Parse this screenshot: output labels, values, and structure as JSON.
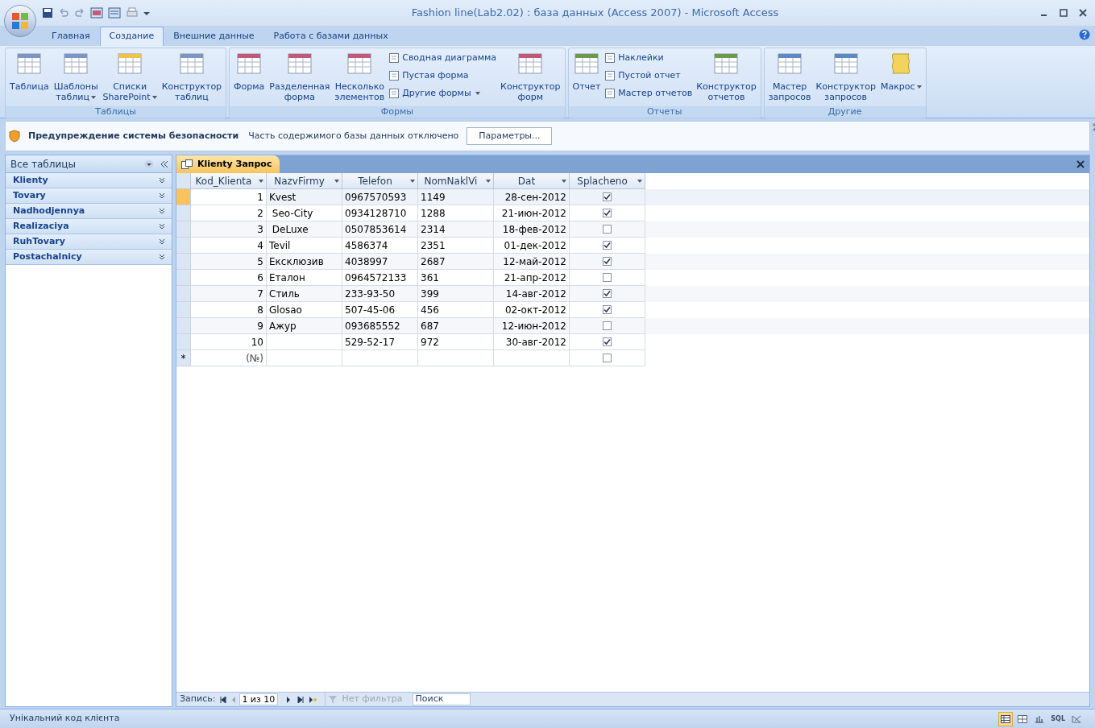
{
  "window": {
    "title": "Fashion line(Lab2.02) : база данных (Access 2007) - Microsoft Access"
  },
  "ribbon_tabs": [
    {
      "label": "Главная",
      "selected": false
    },
    {
      "label": "Создание",
      "selected": true
    },
    {
      "label": "Внешние данные",
      "selected": false
    },
    {
      "label": "Работа с базами данных",
      "selected": false
    }
  ],
  "ribbon_groups": [
    {
      "label": "Таблицы",
      "items": [
        {
          "kind": "large",
          "lines": [
            "Таблица"
          ],
          "dropdown": false
        },
        {
          "kind": "large",
          "lines": [
            "Шаблоны",
            "таблиц"
          ],
          "dropdown": true
        },
        {
          "kind": "large",
          "lines": [
            "Списки",
            "SharePoint"
          ],
          "dropdown": true
        },
        {
          "kind": "large",
          "lines": [
            "Конструктор",
            "таблиц"
          ],
          "dropdown": false
        }
      ]
    },
    {
      "label": "Формы",
      "items": [
        {
          "kind": "large",
          "lines": [
            "Форма"
          ],
          "dropdown": false
        },
        {
          "kind": "large",
          "lines": [
            "Разделенная",
            "форма"
          ],
          "dropdown": false
        },
        {
          "kind": "large",
          "lines": [
            "Несколько",
            "элементов"
          ],
          "dropdown": false
        },
        {
          "kind": "small",
          "lines": [
            "Сводная диаграмма"
          ],
          "dropdown": false
        },
        {
          "kind": "small",
          "lines": [
            "Пустая форма"
          ],
          "dropdown": false
        },
        {
          "kind": "small",
          "lines": [
            "Другие формы"
          ],
          "dropdown": true
        },
        {
          "kind": "large",
          "lines": [
            "Конструктор",
            "форм"
          ],
          "dropdown": false
        }
      ]
    },
    {
      "label": "Отчеты",
      "items": [
        {
          "kind": "large",
          "lines": [
            "Отчет"
          ],
          "dropdown": false
        },
        {
          "kind": "small",
          "lines": [
            "Наклейки"
          ],
          "dropdown": false
        },
        {
          "kind": "small",
          "lines": [
            "Пустой отчет"
          ],
          "dropdown": false
        },
        {
          "kind": "small",
          "lines": [
            "Мастер отчетов"
          ],
          "dropdown": false
        },
        {
          "kind": "large",
          "lines": [
            "Конструктор",
            "отчетов"
          ],
          "dropdown": false
        }
      ]
    },
    {
      "label": "Другие",
      "items": [
        {
          "kind": "large",
          "lines": [
            "Мастер",
            "запросов"
          ],
          "dropdown": false
        },
        {
          "kind": "large",
          "lines": [
            "Конструктор",
            "запросов"
          ],
          "dropdown": false
        },
        {
          "kind": "large",
          "lines": [
            "Макрос"
          ],
          "dropdown": true
        }
      ]
    }
  ],
  "security_bar": {
    "title": "Предупреждение системы безопасности",
    "message": "Часть содержимого базы данных отключено",
    "button": "Параметры..."
  },
  "nav_pane": {
    "header": "Все таблицы",
    "items": [
      {
        "label": "Klienty"
      },
      {
        "label": "Tovary"
      },
      {
        "label": "Nadhodjennya"
      },
      {
        "label": "Realizaciya"
      },
      {
        "label": "RuhTovary"
      },
      {
        "label": "Postachalnicy"
      }
    ]
  },
  "document_tab": {
    "label": "Klienty Запрос"
  },
  "table": {
    "columns": [
      "Kod_Klienta",
      "NazvFirmy",
      "Telefon",
      "NomNaklVi",
      "Dat",
      "Splacheno"
    ],
    "rows": [
      {
        "selected": true,
        "cells": [
          "1",
          "Kvest",
          "0967570593",
          "1149",
          "28-сен-2012"
        ],
        "checked": true
      },
      {
        "selected": false,
        "cells": [
          "2",
          " Seo-City",
          "0934128710",
          "1288",
          "21-июн-2012"
        ],
        "checked": true
      },
      {
        "selected": false,
        "cells": [
          "3",
          " DeLuxe",
          "0507853614",
          "2314",
          "18-фев-2012"
        ],
        "checked": false
      },
      {
        "selected": false,
        "cells": [
          "4",
          "Tevil",
          "4586374",
          "2351",
          "01-дек-2012"
        ],
        "checked": true
      },
      {
        "selected": false,
        "cells": [
          "5",
          "Ексклюзив",
          "4038997",
          "2687",
          "12-май-2012"
        ],
        "checked": true
      },
      {
        "selected": false,
        "cells": [
          "6",
          "Еталон",
          "0964572133",
          "361",
          "21-апр-2012"
        ],
        "checked": false
      },
      {
        "selected": false,
        "cells": [
          "7",
          "Стиль",
          "233-93-50",
          "399",
          "14-авг-2012"
        ],
        "checked": true
      },
      {
        "selected": false,
        "cells": [
          "8",
          "Glosao",
          "507-45-06",
          "456",
          "02-окт-2012"
        ],
        "checked": true
      },
      {
        "selected": false,
        "cells": [
          "9",
          "Ажур",
          "093685552",
          "687",
          "12-июн-2012"
        ],
        "checked": false
      },
      {
        "selected": false,
        "cells": [
          "10",
          "",
          "529-52-17",
          "972",
          "30-авг-2012"
        ],
        "checked": true
      }
    ],
    "new_row": {
      "marker": "*",
      "placeholder": "(№)",
      "checked": false
    }
  },
  "record_nav": {
    "label": "Запись:",
    "position": "1 из 10",
    "filter": {
      "label": "Нет фильтра",
      "disabled": true
    },
    "search": {
      "placeholder": "Поиск"
    }
  },
  "status_bar": {
    "text": "Унікальний код клієнта",
    "views": [
      {
        "kind": "datasheet",
        "selected": true
      },
      {
        "kind": "pivot-table",
        "selected": false
      },
      {
        "kind": "pivot-chart",
        "selected": false
      },
      {
        "kind": "sql",
        "label": "SQL",
        "selected": false
      },
      {
        "kind": "design",
        "selected": false
      }
    ]
  }
}
